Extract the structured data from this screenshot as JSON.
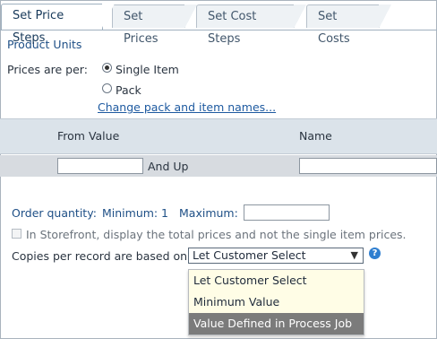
{
  "tabs": [
    {
      "label": "Set Price Steps",
      "active": true
    },
    {
      "label": "Set Prices",
      "active": false
    },
    {
      "label": "Set Cost Steps",
      "active": false
    },
    {
      "label": "Set Costs",
      "active": false
    }
  ],
  "section_title": "Product Units",
  "prices_are_per": {
    "label": "Prices are per:",
    "options": [
      "Single Item",
      "Pack"
    ],
    "selected": "Single Item"
  },
  "change_link": "Change pack and item names...",
  "table": {
    "headers": [
      "From Value",
      "Name"
    ],
    "row": {
      "from_value": "",
      "suffix": "And Up",
      "name": ""
    }
  },
  "order_quantity": {
    "label": "Order quantity:",
    "minimum_label": "Minimum:",
    "minimum_value": "1",
    "maximum_label": "Maximum:",
    "maximum_value": ""
  },
  "storefront_checkbox": {
    "label": "In Storefront, display the total prices and not the single item prices.",
    "checked": false,
    "disabled": true
  },
  "copies": {
    "label": "Copies per record are based on:",
    "selected": "Let Customer Select",
    "help": "?",
    "options": [
      "Let Customer Select",
      "Minimum Value",
      "Value Defined in Process Job"
    ],
    "highlighted": "Value Defined in Process Job"
  },
  "colors": {
    "accent": "#1e4f86",
    "header_bg": "#dbe3ea",
    "highlight_bg": "#7b7b7b",
    "dropdown_bg": "#fffde6",
    "help_icon": "#2f7fd0"
  }
}
